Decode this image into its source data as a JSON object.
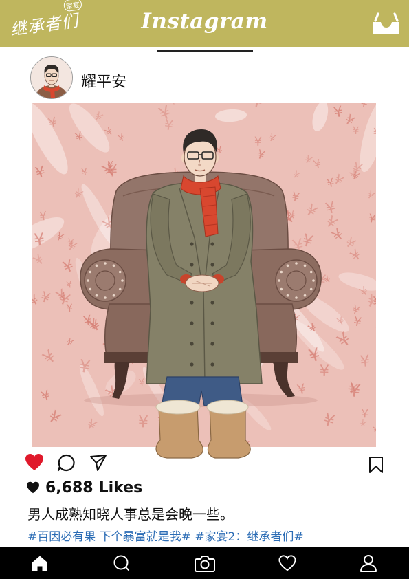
{
  "header": {
    "logo_text": "继承者们",
    "logo_seal": "家宴",
    "title": "Instagram",
    "inbox_icon": "inbox-tray-icon",
    "background_color": "#bfb65e"
  },
  "profile": {
    "name": "耀平安",
    "avatar_icon": "avatar-portrait-icon"
  },
  "post": {
    "pattern_glyph": "¥",
    "background_color": "#ecc0b8",
    "pattern_color": "#d57b70"
  },
  "actions": {
    "like_icon": "heart-filled-icon",
    "comment_icon": "comment-bubble-icon",
    "share_icon": "send-paper-plane-icon",
    "save_icon": "bookmark-icon",
    "like_color": "#e0192b"
  },
  "likes": {
    "icon": "heart-icon",
    "count": "6,688",
    "label": "Likes"
  },
  "caption": "男人成熟知晓人事总是会晚一些。",
  "hashtags": [
    "#百因必有果 下个暴富就是我#",
    "#家宴2：继承者们#"
  ],
  "hashtag_color": "#2b6cb5",
  "bottom_nav": {
    "home_icon": "home-icon",
    "search_icon": "search-icon",
    "camera_icon": "camera-icon",
    "activity_icon": "heart-outline-icon",
    "profile_icon": "profile-person-icon",
    "background_color": "#000000"
  }
}
